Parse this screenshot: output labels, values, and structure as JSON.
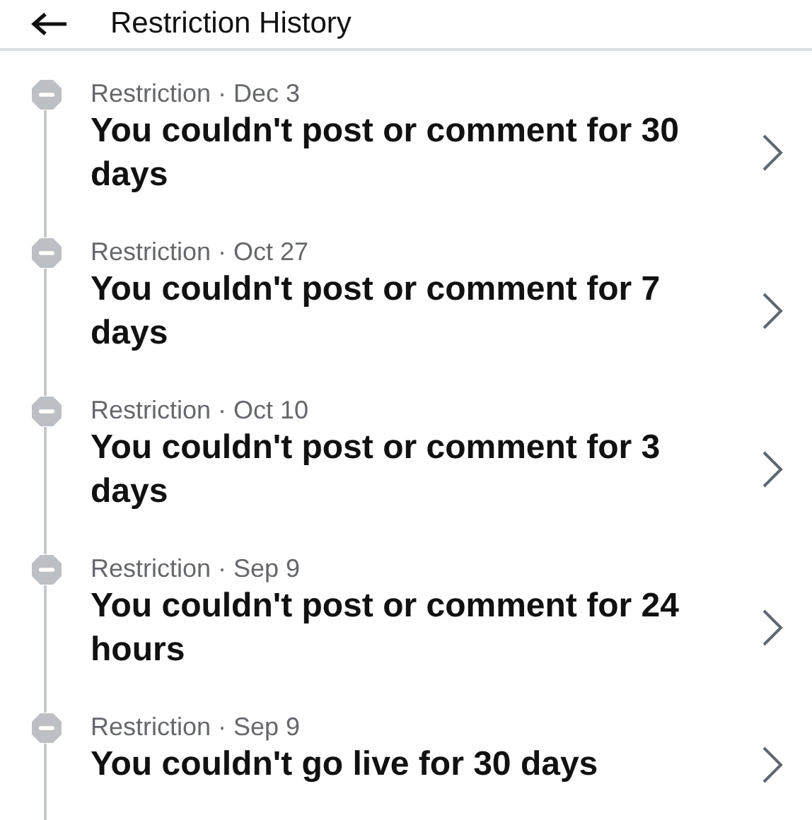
{
  "header": {
    "title": "Restriction History"
  },
  "restrictions": [
    {
      "meta": "Restriction · Dec 3",
      "description": "You couldn't post or comment for 30 days"
    },
    {
      "meta": "Restriction · Oct 27",
      "description": "You couldn't post or comment for 7 days"
    },
    {
      "meta": "Restriction · Oct 10",
      "description": "You couldn't post or comment for 3 days"
    },
    {
      "meta": "Restriction · Sep 9",
      "description": "You couldn't post or comment for 24 hours"
    },
    {
      "meta": "Restriction · Sep 9",
      "description": "You couldn't go live for 30 days"
    }
  ]
}
